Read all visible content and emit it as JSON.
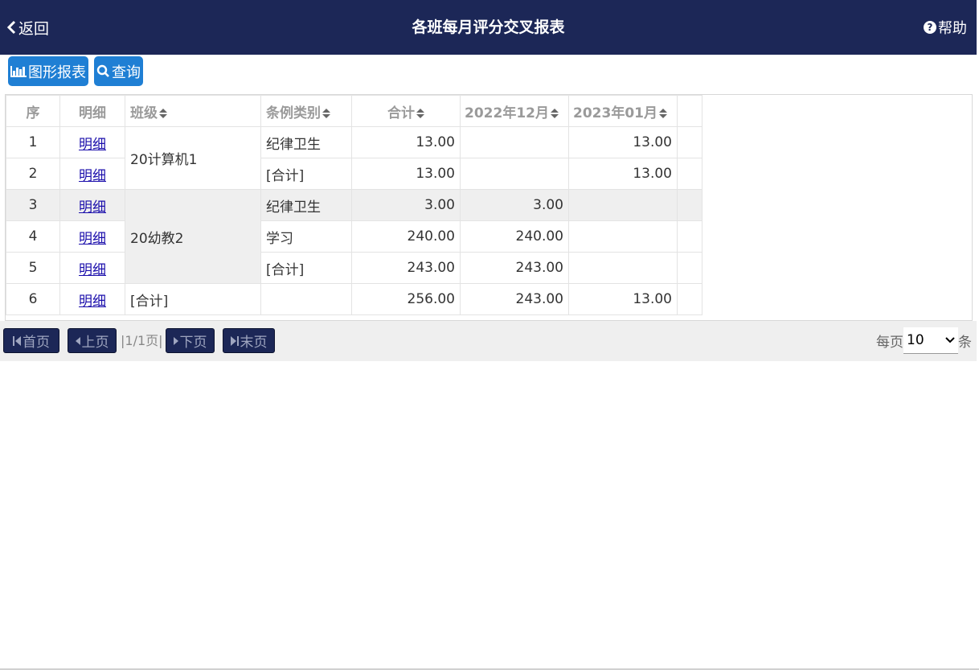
{
  "header": {
    "back_label": "返回",
    "title": "各班每月评分交叉报表",
    "help_label": "帮助"
  },
  "toolbar": {
    "chart_report_label": "图形报表",
    "query_label": "查询"
  },
  "table": {
    "columns": [
      "序",
      "明细",
      "班级",
      "条例类别",
      "合计",
      "2022年12月",
      "2023年01月"
    ],
    "rows": [
      {
        "seq": "1",
        "detail": "明细",
        "class": "20计算机1",
        "category": "纪律卫生",
        "total": "13.00",
        "m2022_12": "",
        "m2023_01": "13.00"
      },
      {
        "seq": "2",
        "detail": "明细",
        "class": "",
        "category": "[合计]",
        "total": "13.00",
        "m2022_12": "",
        "m2023_01": "13.00"
      },
      {
        "seq": "3",
        "detail": "明细",
        "class": "20幼教2",
        "category": "纪律卫生",
        "total": "3.00",
        "m2022_12": "3.00",
        "m2023_01": ""
      },
      {
        "seq": "4",
        "detail": "明细",
        "class": "",
        "category": "学习",
        "total": "240.00",
        "m2022_12": "240.00",
        "m2023_01": ""
      },
      {
        "seq": "5",
        "detail": "明细",
        "class": "",
        "category": "[合计]",
        "total": "243.00",
        "m2022_12": "243.00",
        "m2023_01": ""
      },
      {
        "seq": "6",
        "detail": "明细",
        "class": "[合计]",
        "category": "",
        "total": "256.00",
        "m2022_12": "243.00",
        "m2023_01": "13.00"
      }
    ]
  },
  "pager": {
    "first_label": "首页",
    "prev_label": "上页",
    "page_info": "|1/1页|",
    "next_label": "下页",
    "last_label": "末页",
    "per_page_prefix": "每页",
    "per_page_value": "10",
    "per_page_suffix": "条"
  },
  "colors": {
    "header_bg": "#1c2757",
    "button_blue": "#1f7fd4",
    "highlight_row": "#efefef"
  }
}
